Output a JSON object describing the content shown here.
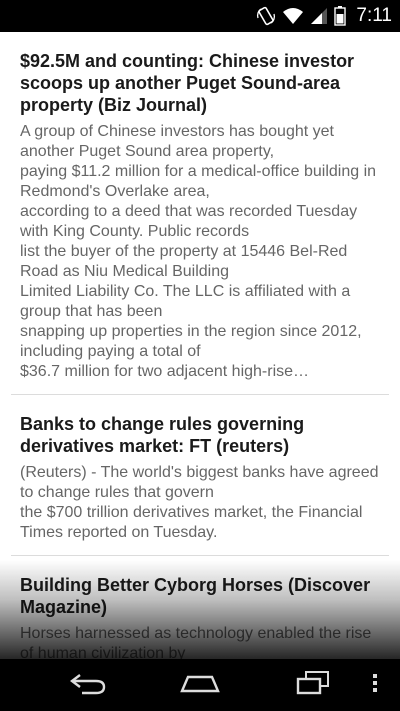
{
  "status_bar": {
    "time": "7:11",
    "icons": [
      "screen-rotation-icon",
      "wifi-icon",
      "cell-signal-icon",
      "battery-icon"
    ]
  },
  "articles": [
    {
      "title": "$92.5M and counting: Chinese investor scoops up another Puget Sound-area property (Biz Journal)",
      "body": "A group of Chinese investors has bought yet another Puget Sound area property,\npaying $11.2 million for a medical-office building in Redmond's Overlake area,\naccording to a deed that was recorded Tuesday with King County. Public records\nlist the buyer of the property at 15446 Bel-Red Road as Niu Medical Building\nLimited Liability Co. The LLC is affiliated with a group that has been\nsnapping up properties in the region since 2012, including paying a total of\n$36.7 million for two adjacent high-rise…"
    },
    {
      "title": "Banks to change rules governing derivatives market: FT (reuters)",
      "body": "(Reuters) - The world's biggest banks have agreed to change rules that govern\nthe $700 trillion derivatives market, the Financial Times reported on Tuesday."
    },
    {
      "title": "Building Better Cyborg Horses (Discover Magazine)",
      "body": "Horses harnessed as technology enabled the rise of human civilization by\nhauling heavy loads, opening new trade and"
    }
  ],
  "nav_bar": {
    "icons": [
      "back-icon",
      "home-icon",
      "recent-apps-icon",
      "menu-icon"
    ]
  },
  "colors": {
    "title": "#1a1a1a",
    "body": "#666666",
    "divider": "#dcdcdc",
    "bars": "#000000"
  }
}
